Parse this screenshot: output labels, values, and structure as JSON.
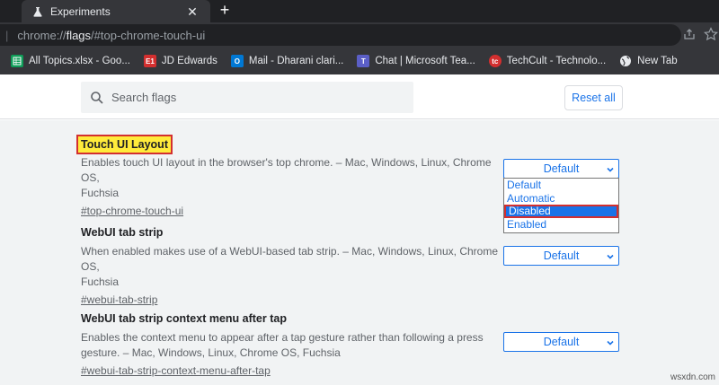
{
  "tab": {
    "title": "Experiments"
  },
  "address": {
    "scheme": "chrome://",
    "host": "flags",
    "path": "/#top-chrome-touch-ui"
  },
  "bookmarks": [
    {
      "label": "All Topics.xlsx - Goo...",
      "icon_color": "#0f9d58",
      "icon_text": ""
    },
    {
      "label": "JD Edwards",
      "icon_color": "#d32f2f",
      "icon_text": "E1"
    },
    {
      "label": "Mail - Dharani clari...",
      "icon_color": "#0078d4",
      "icon_text": "O"
    },
    {
      "label": "Chat | Microsoft Tea...",
      "icon_color": "#5b5fc7",
      "icon_text": "T"
    },
    {
      "label": "TechCult - Technolo...",
      "icon_color": "#d32f2f",
      "icon_text": "tc"
    },
    {
      "label": "New Tab",
      "icon_color": "#e8eaed",
      "icon_text": ""
    }
  ],
  "search": {
    "placeholder": "Search flags"
  },
  "reset_label": "Reset all",
  "flags": [
    {
      "title": "Touch UI Layout",
      "desc_line1": "Enables touch UI layout in the browser's top chrome. – Mac, Windows, Linux, Chrome OS,",
      "desc_line2": "Fuchsia",
      "link": "#top-chrome-touch-ui",
      "value": "Default",
      "options": [
        "Default",
        "Automatic",
        "Disabled",
        "Enabled"
      ],
      "highlighted_option": "Disabled"
    },
    {
      "title": "WebUI tab strip",
      "desc_line1": "When enabled makes use of a WebUI-based tab strip. – Mac, Windows, Linux, Chrome OS,",
      "desc_line2": "Fuchsia",
      "link": "#webui-tab-strip",
      "value": "Default"
    },
    {
      "title": "WebUI tab strip context menu after tap",
      "desc_line1": "Enables the context menu to appear after a tap gesture rather than following a press",
      "desc_line2": "gesture. – Mac, Windows, Linux, Chrome OS, Fuchsia",
      "link": "#webui-tab-strip-context-menu-after-tap",
      "value": "Default"
    }
  ],
  "watermark": "wsxdn.com",
  "colors": {
    "accent": "#1a73e8",
    "highlight_border": "#d32f2f",
    "highlight_fill": "#ffeb3b"
  }
}
